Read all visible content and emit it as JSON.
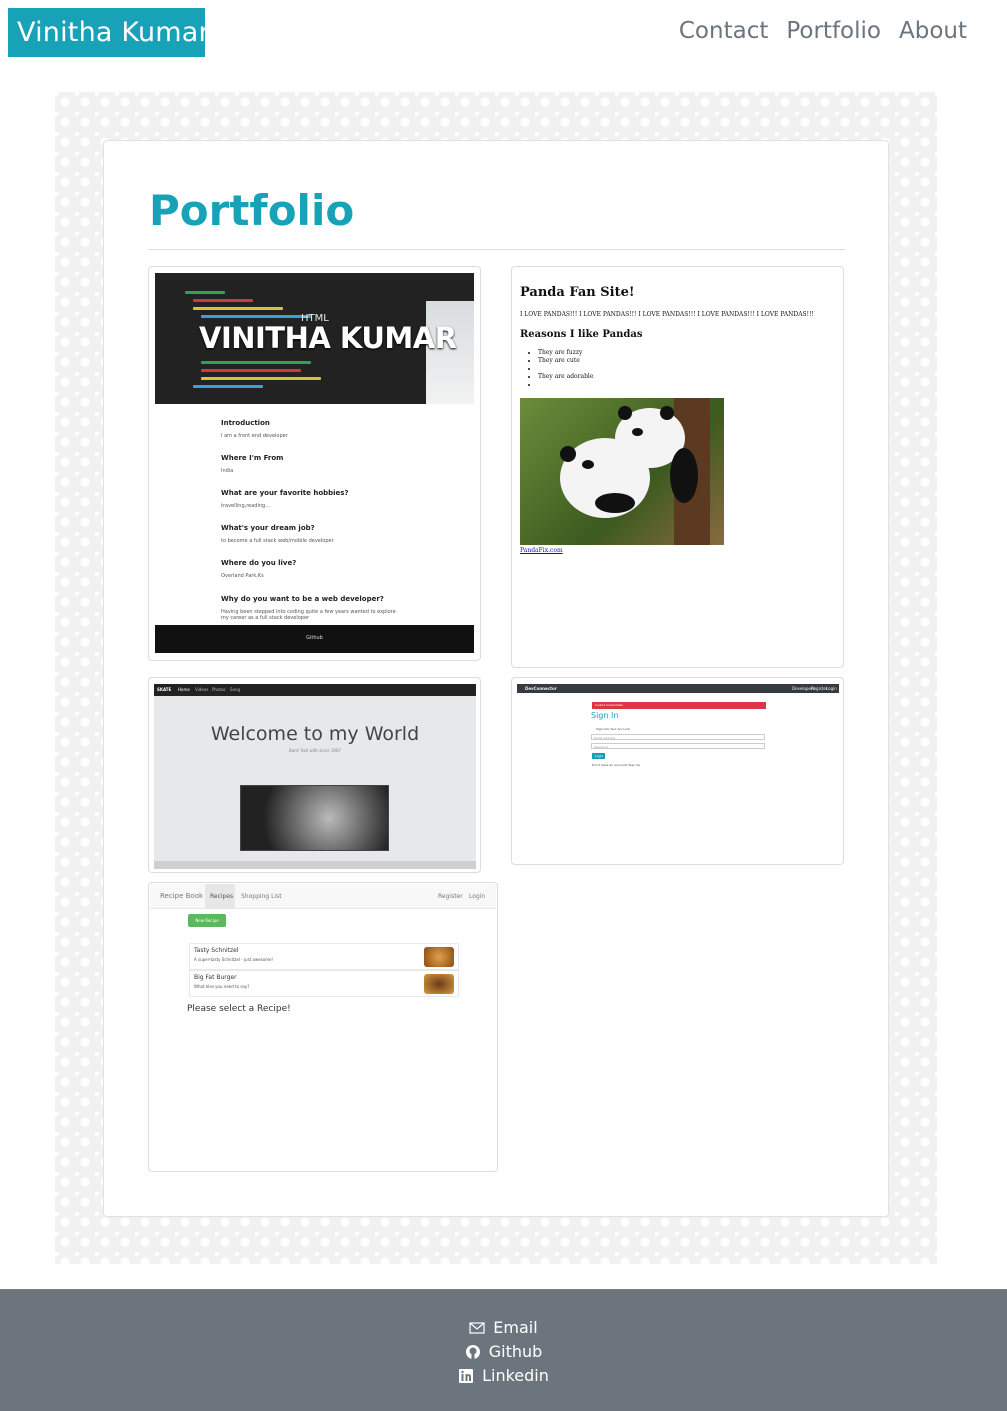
{
  "header": {
    "brand": "Vinitha Kumar",
    "nav": [
      "Contact",
      "Portfolio",
      "About"
    ]
  },
  "main": {
    "title": "Portfolio",
    "projects": [
      {
        "id": "about-me",
        "hero_title": "VINITHA KUMAR",
        "hero_small": "HTML",
        "sections": [
          {
            "q": "Introduction",
            "a": "I am a front end developer"
          },
          {
            "q": "Where I'm From",
            "a": "India"
          },
          {
            "q": "What are your favorite hobbies?",
            "a": "travelling,reading..."
          },
          {
            "q": "What's your dream job?",
            "a": "to become a full stack web/mobile developer"
          },
          {
            "q": "Where do you live?",
            "a": "Overland Park,Ks"
          },
          {
            "q": "Why do you want to be a web developer?",
            "a": "Having been stepped into coding quite a few years wanted to explore my career as a full stack developer"
          }
        ],
        "footer": "Github"
      },
      {
        "id": "panda-fan-site",
        "title": "Panda Fan Site!",
        "love": "I LOVE PANDAS!!! I LOVE PANDAS!!! I LOVE PANDAS!!! I LOVE PANDAS!!! I LOVE PANDAS!!!",
        "subtitle": "Reasons I like Pandas",
        "reasons": [
          "They are fuzzy",
          "They are cute",
          "",
          "They are adorable",
          ""
        ],
        "link": "PandaFix.com"
      },
      {
        "id": "skate",
        "brand": "SKATE",
        "nav": [
          "Home",
          "Videos",
          "Photos",
          "Song"
        ],
        "welcome": "Welcome to my World",
        "sub": "Bam! Roll with since 1987"
      },
      {
        "id": "devconnector",
        "brand": "DevConnector",
        "nav": [
          "Developers",
          "Register",
          "Login"
        ],
        "alert": "Invalid Credentials",
        "heading": "Sign In",
        "lead": "Sign into Your Account",
        "email_ph": "Email Address",
        "password_ph": "Password",
        "button": "Login",
        "register_prompt": "Don't have an account? Sign Up"
      },
      {
        "id": "recipe-book",
        "brand": "Recipe Book",
        "nav": [
          "Recipes",
          "Shopping List"
        ],
        "right_nav": [
          "Register",
          "Login"
        ],
        "new_button": "New Recipe",
        "recipes": [
          {
            "name": "Tasty Schnitzel",
            "desc": "A super-tasty Schnitzel - just awesome!"
          },
          {
            "name": "Big Fat Burger",
            "desc": "What else you need to say?"
          }
        ],
        "select_prompt": "Please select a Recipe!"
      }
    ]
  },
  "footer": {
    "links": [
      {
        "label": "Email",
        "icon": "envelope-icon"
      },
      {
        "label": "Github",
        "icon": "github-icon"
      },
      {
        "label": "Linkedin",
        "icon": "linkedin-icon"
      }
    ]
  },
  "colors": {
    "accent": "#17a2b8",
    "nav_text": "#6c757d",
    "footer_bg": "#6c757d"
  }
}
